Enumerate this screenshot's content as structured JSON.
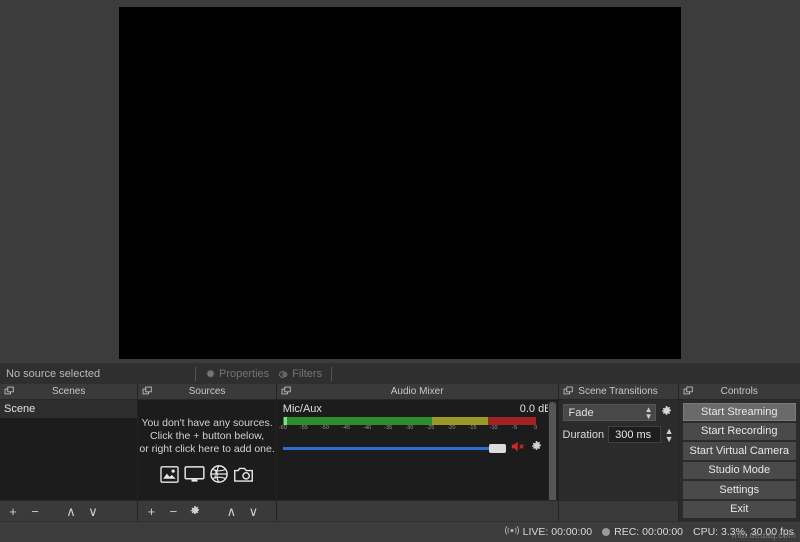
{
  "preview": {
    "label": "preview-canvas",
    "background_color": "#000000"
  },
  "source_strip": {
    "status_text": "No source selected",
    "properties_label": "Properties",
    "filters_label": "Filters"
  },
  "docks": {
    "scenes": {
      "title": "Scenes",
      "items": [
        {
          "name": "Scene"
        }
      ],
      "toolbar": [
        "+",
        "−",
        "∧",
        "∨"
      ]
    },
    "sources": {
      "title": "Sources",
      "empty_line1": "You don't have any sources.",
      "empty_line2": "Click the + button below,",
      "empty_line3": "or right click here to add one.",
      "icons": [
        "image-icon",
        "display-capture-icon",
        "browser-icon",
        "camera-icon"
      ],
      "toolbar": [
        "+",
        "−",
        "gear",
        "∧",
        "∨"
      ]
    },
    "audio_mixer": {
      "title": "Audio Mixer",
      "tracks": [
        {
          "name": "Mic/Aux",
          "level_db": "0.0 dB",
          "volume_percent": 93,
          "muted": true,
          "meter": {
            "green_pct": 59,
            "yellow_pct": 22,
            "red_pct": 19
          },
          "scale_ticks": [
            "-60",
            "-55",
            "-50",
            "-45",
            "-40",
            "-35",
            "-30",
            "-25",
            "-20",
            "-15",
            "-10",
            "-5",
            "0"
          ]
        }
      ]
    },
    "scene_transitions": {
      "title": "Scene Transitions",
      "transition_selected": "Fade",
      "duration_label": "Duration",
      "duration_value": "300 ms"
    },
    "controls": {
      "title": "Controls",
      "buttons": [
        {
          "label": "Start Streaming",
          "primary": true
        },
        {
          "label": "Start Recording",
          "primary": false
        },
        {
          "label": "Start Virtual Camera",
          "primary": false
        },
        {
          "label": "Studio Mode",
          "primary": false
        },
        {
          "label": "Settings",
          "primary": false
        },
        {
          "label": "Exit",
          "primary": false
        }
      ]
    }
  },
  "statusbar": {
    "live_label": "LIVE: 00:00:00",
    "rec_label": "REC: 00:00:00",
    "cpu_label": "CPU: 3.3%, 30.00 fps",
    "watermark": "moi.deuaq.com"
  },
  "colors": {
    "accent_blue": "#2d6fd0",
    "meter_green": "#2e8b2e",
    "meter_yellow": "#9a9a28",
    "meter_red": "#a02222",
    "mute_red": "#d62828",
    "panel_bg": "#2b2b2b",
    "dock_header": "#3a3a3a"
  }
}
